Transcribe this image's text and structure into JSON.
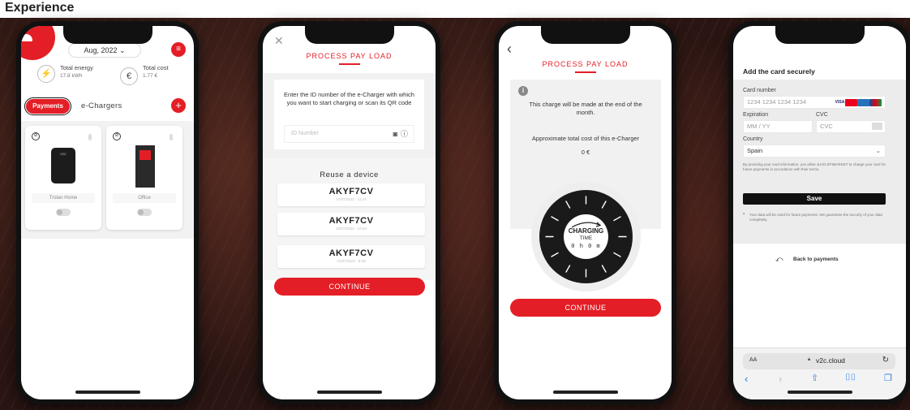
{
  "header": {
    "title": "Experience"
  },
  "phone1": {
    "date": "Aug, 2022",
    "total_energy_label": "Total energy",
    "total_energy_value": "17.8 kWh",
    "total_cost_label": "Total cost",
    "total_cost_value": "1.77 €",
    "tab_payments": "Payments",
    "tab_echargers": "e-Chargers",
    "devices": [
      {
        "name": "Trolan Home",
        "brand": "V2C"
      },
      {
        "name": "Office"
      }
    ]
  },
  "phone2": {
    "title": "PROCESS PAY LOAD",
    "instructions": "Enter the ID number of the e-Charger with which you want to start charging or scan its QR code",
    "id_placeholder": "ID Number",
    "reuse_title": "Reuse a device",
    "reuse_items": [
      {
        "id": "AKYF7CV",
        "date": "27/07/2022 - 11:44"
      },
      {
        "id": "AKYF7CV",
        "date": "22/07/2022 - 13:33"
      },
      {
        "id": "AKYF7CV",
        "date": "21/07/2022 - 8:49"
      }
    ],
    "continue_label": "CONTINUE"
  },
  "phone3": {
    "title": "PROCESS PAY LOAD",
    "notice": "This charge will be made at the end of the month.",
    "cost_label": "Approximate total cost of this e-Charger",
    "cost_value": "0 €",
    "dial_title": "CHARGING",
    "dial_subtitle": "TIME",
    "dial_time": "0 h 0 m",
    "continue_label": "CONTINUE"
  },
  "phone4": {
    "header": "Add the card securely",
    "card_number_label": "Card number",
    "card_number_placeholder": "1234 1234 1234 1234",
    "expiration_label": "Expiration",
    "expiration_placeholder": "MM / YY",
    "cvc_label": "CVC",
    "cvc_placeholder": "CVC",
    "country_label": "Country",
    "country_value": "Spain",
    "consent_text": "By providing your card information, you allow JUAN EFIMARKET to charge your card for future payments in accordance with their terms.",
    "save_label": "Save",
    "security_note": "Your data will be used for future payments. We guarantee the security of your data completely.",
    "back_label": "Back to payments",
    "url": "v2c.cloud",
    "text_size_label": "AA",
    "card_brands": [
      "VISA",
      "MC",
      "AMEX",
      "JCB"
    ]
  },
  "colors": {
    "accent": "#e41e26",
    "dark": "#111111"
  }
}
